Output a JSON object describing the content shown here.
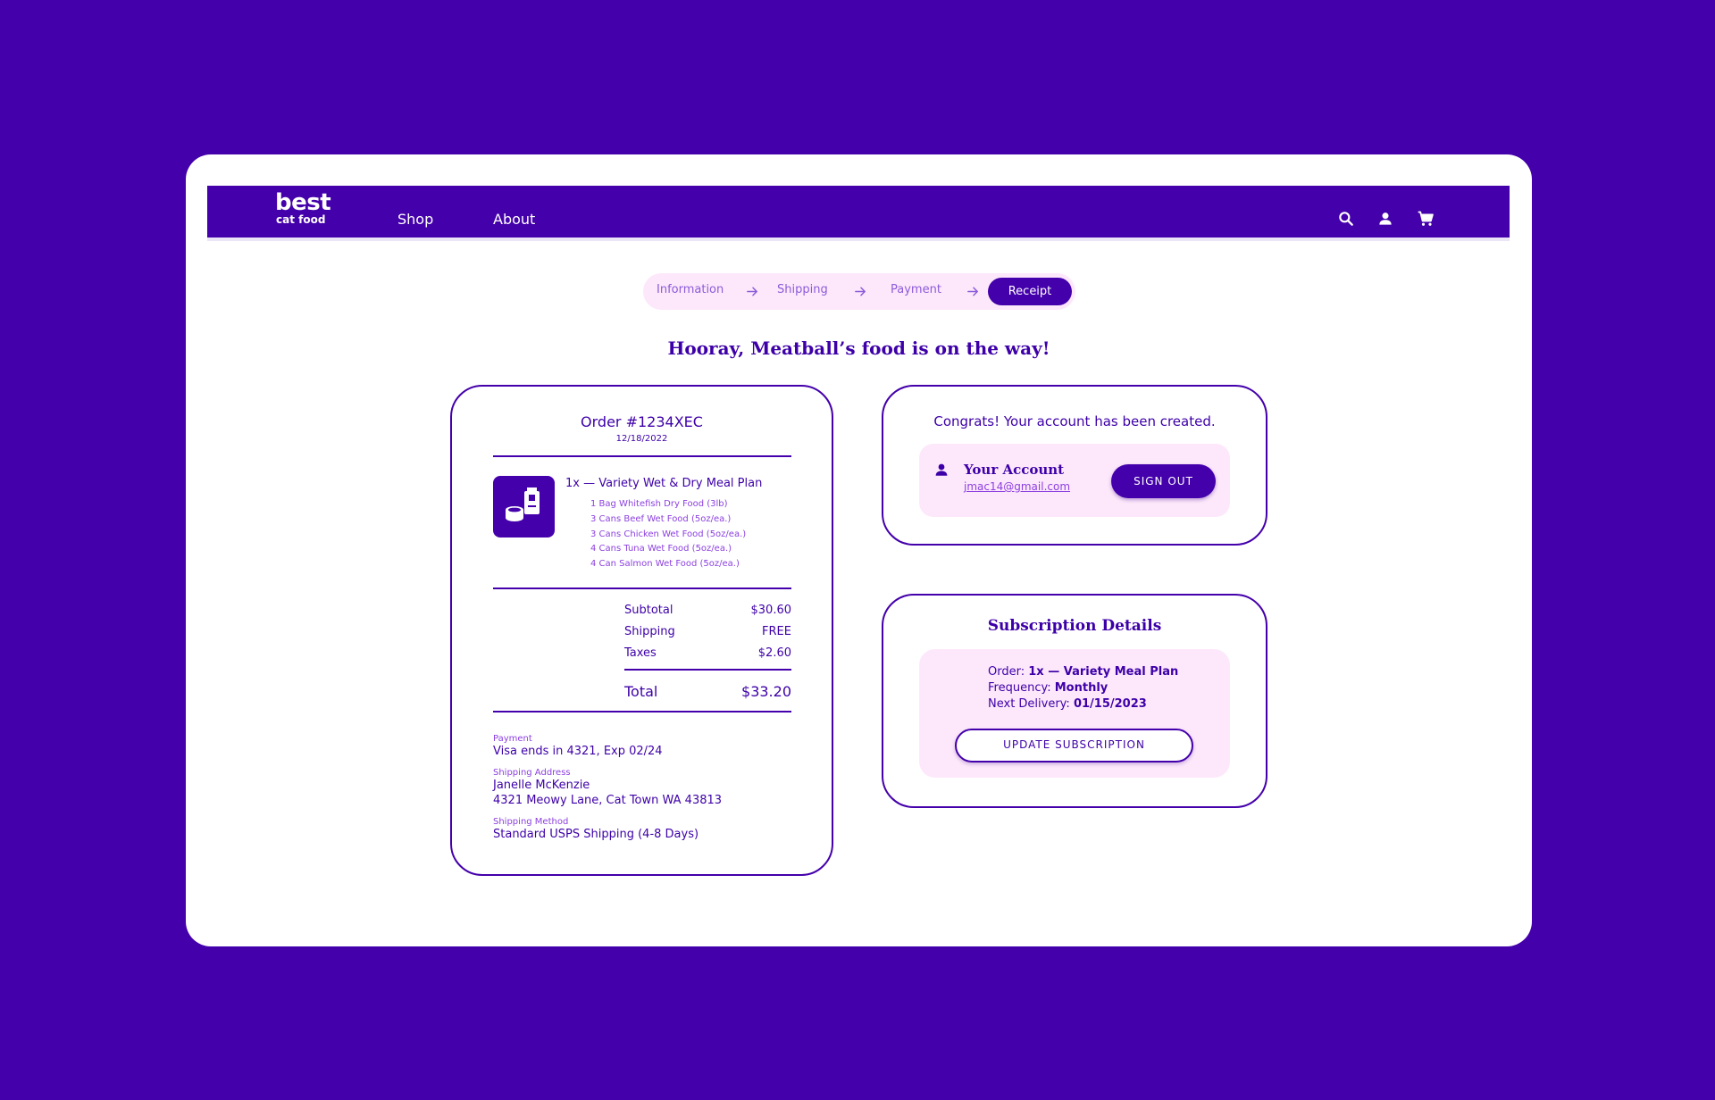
{
  "colors": {
    "brand": "#4400ab",
    "accent_light": "#fde8fb",
    "text": "#3d00a8",
    "muted": "#8c40e0"
  },
  "nav": {
    "logo_main": "best",
    "logo_sub": "cat food",
    "links": [
      "Shop",
      "About"
    ],
    "icons": [
      "search-icon",
      "user-icon",
      "cart-icon"
    ]
  },
  "stepper": {
    "steps": [
      "Information",
      "Shipping",
      "Payment"
    ],
    "active": "Receipt"
  },
  "headline": "Hooray, Meatball’s food is on the way!",
  "order": {
    "title": "Order #1234XEC",
    "date": "12/18/2022",
    "product_name": "1x — Variety Wet & Dry Meal Plan",
    "items": [
      "1 Bag Whitefish Dry Food (3lb)",
      "3 Cans Beef Wet Food (5oz/ea.)",
      "3 Cans Chicken Wet Food (5oz/ea.)",
      "4 Cans Tuna Wet Food (5oz/ea.)",
      "4 Can Salmon Wet Food (5oz/ea.)"
    ],
    "subtotal_label": "Subtotal",
    "subtotal": "$30.60",
    "shipping_label": "Shipping",
    "shipping": "FREE",
    "taxes_label": "Taxes",
    "taxes": "$2.60",
    "total_label": "Total",
    "total": "$33.20",
    "payment_label": "Payment",
    "payment": "Visa ends in 4321, Exp 02/24",
    "address_label": "Shipping Address",
    "address_name": "Janelle McKenzie",
    "address_street": "4321 Meowy Lane, Cat Town WA 43813",
    "method_label": "Shipping Method",
    "method": "Standard USPS Shipping (4-8 Days)"
  },
  "account": {
    "message": "Congrats! Your account has been created.",
    "title": "Your Account",
    "email": "jmac14@gmail.com",
    "sign_out": "SIGN OUT"
  },
  "subscription": {
    "title": "Subscription Details",
    "order_label": "Order: ",
    "order_value": "1x — Variety Meal Plan",
    "frequency_label": "Frequency: ",
    "frequency_value": "Monthly",
    "next_label": "Next Delivery: ",
    "next_value": "01/15/2023",
    "update_button": "UPDATE SUBSCRIPTION"
  }
}
